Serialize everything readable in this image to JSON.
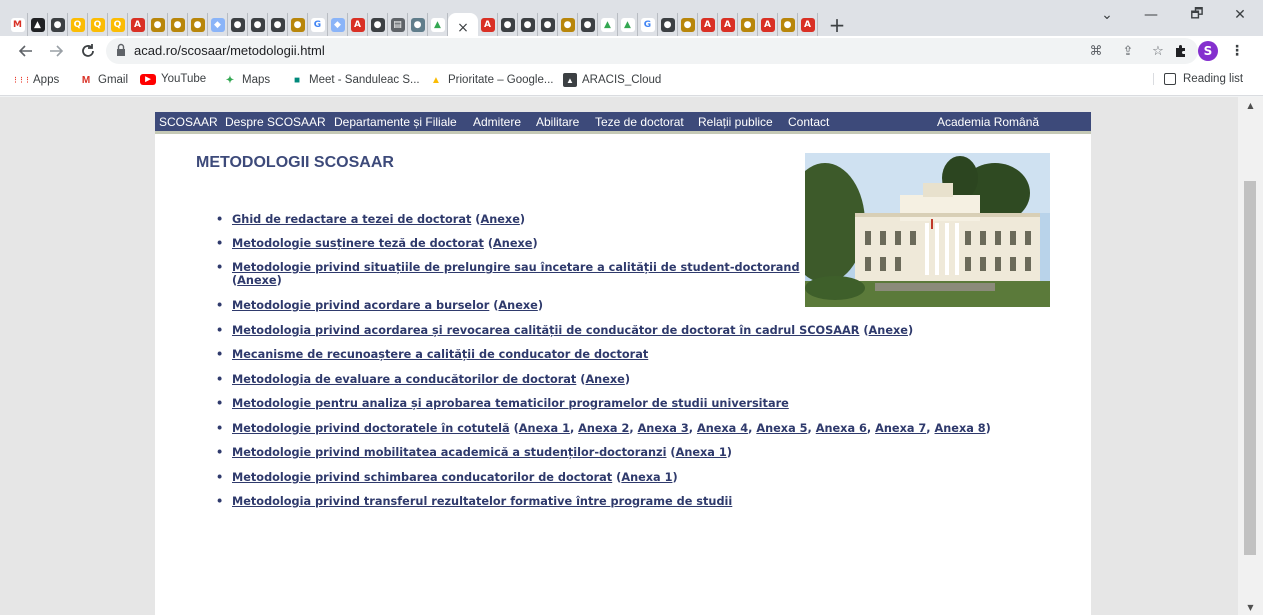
{
  "browser": {
    "tabs": {
      "favicons": [
        {
          "name": "gmail-icon",
          "glyph": "M",
          "bg": "#ffffff",
          "fg": "#d93025"
        },
        {
          "name": "aracis-icon",
          "glyph": "▲",
          "bg": "#202124",
          "fg": "#ffffff"
        },
        {
          "name": "chrome-icon",
          "glyph": "●",
          "bg": "#3c4043",
          "fg": "#ffffff"
        },
        {
          "name": "search-icon",
          "glyph": "Q",
          "bg": "#fbbc04",
          "fg": "#ffffff"
        },
        {
          "name": "search-icon",
          "glyph": "Q",
          "bg": "#fbbc04",
          "fg": "#ffffff"
        },
        {
          "name": "search-icon",
          "glyph": "Q",
          "bg": "#fbbc04",
          "fg": "#ffffff"
        },
        {
          "name": "pdf-icon",
          "glyph": "A",
          "bg": "#d93025",
          "fg": "#ffffff"
        },
        {
          "name": "seal-icon",
          "glyph": "●",
          "bg": "#b8860b",
          "fg": "#ffffff"
        },
        {
          "name": "seal-icon",
          "glyph": "●",
          "bg": "#b8860b",
          "fg": "#ffffff"
        },
        {
          "name": "seal-icon",
          "glyph": "●",
          "bg": "#b8860b",
          "fg": "#ffffff"
        },
        {
          "name": "diamond-icon",
          "glyph": "◆",
          "bg": "#8ab4f8",
          "fg": "#ffffff"
        },
        {
          "name": "chrome-icon",
          "glyph": "●",
          "bg": "#3c4043",
          "fg": "#ffffff"
        },
        {
          "name": "chrome-icon",
          "glyph": "●",
          "bg": "#3c4043",
          "fg": "#ffffff"
        },
        {
          "name": "chrome-icon",
          "glyph": "●",
          "bg": "#3c4043",
          "fg": "#ffffff"
        },
        {
          "name": "seal-icon",
          "glyph": "●",
          "bg": "#b8860b",
          "fg": "#ffffff"
        },
        {
          "name": "google-icon",
          "glyph": "G",
          "bg": "#ffffff",
          "fg": "#4285f4"
        },
        {
          "name": "diamond-icon",
          "glyph": "◆",
          "bg": "#8ab4f8",
          "fg": "#ffffff"
        },
        {
          "name": "pdf-icon",
          "glyph": "A",
          "bg": "#d93025",
          "fg": "#ffffff"
        },
        {
          "name": "chrome-icon",
          "glyph": "●",
          "bg": "#3c4043",
          "fg": "#ffffff"
        },
        {
          "name": "doc-icon",
          "glyph": "▤",
          "bg": "#5f6368",
          "fg": "#ffffff"
        },
        {
          "name": "seal-icon",
          "glyph": "●",
          "bg": "#607d8b",
          "fg": "#ffffff"
        },
        {
          "name": "drive-icon",
          "glyph": "▲",
          "bg": "#ffffff",
          "fg": "#34a853"
        }
      ],
      "active_close": "×",
      "favicons_after": [
        {
          "name": "pdf-icon",
          "glyph": "A",
          "bg": "#d93025",
          "fg": "#ffffff"
        },
        {
          "name": "chrome-icon",
          "glyph": "●",
          "bg": "#3c4043",
          "fg": "#ffffff"
        },
        {
          "name": "chrome-icon",
          "glyph": "●",
          "bg": "#3c4043",
          "fg": "#ffffff"
        },
        {
          "name": "chrome-icon",
          "glyph": "●",
          "bg": "#3c4043",
          "fg": "#ffffff"
        },
        {
          "name": "seal-icon",
          "glyph": "●",
          "bg": "#b8860b",
          "fg": "#ffffff"
        },
        {
          "name": "chrome-icon",
          "glyph": "●",
          "bg": "#3c4043",
          "fg": "#ffffff"
        },
        {
          "name": "drive-icon",
          "glyph": "▲",
          "bg": "#ffffff",
          "fg": "#34a853"
        },
        {
          "name": "drive-icon",
          "glyph": "▲",
          "bg": "#ffffff",
          "fg": "#34a853"
        },
        {
          "name": "google-icon",
          "glyph": "G",
          "bg": "#ffffff",
          "fg": "#4285f4"
        },
        {
          "name": "chrome-icon",
          "glyph": "●",
          "bg": "#3c4043",
          "fg": "#ffffff"
        },
        {
          "name": "seal-icon",
          "glyph": "●",
          "bg": "#b8860b",
          "fg": "#ffffff"
        },
        {
          "name": "pdf-icon",
          "glyph": "A",
          "bg": "#d93025",
          "fg": "#ffffff"
        },
        {
          "name": "pdf-icon",
          "glyph": "A",
          "bg": "#d93025",
          "fg": "#ffffff"
        },
        {
          "name": "seal-icon",
          "glyph": "●",
          "bg": "#b8860b",
          "fg": "#ffffff"
        },
        {
          "name": "pdf-icon",
          "glyph": "A",
          "bg": "#d93025",
          "fg": "#ffffff"
        },
        {
          "name": "seal-icon",
          "glyph": "●",
          "bg": "#b8860b",
          "fg": "#ffffff"
        },
        {
          "name": "pdf-icon",
          "glyph": "A",
          "bg": "#d93025",
          "fg": "#ffffff"
        }
      ],
      "new_tab": "+"
    },
    "window_controls": {
      "tab_search": "⌄",
      "minimize": "—",
      "maximize": "🗗",
      "close": "✕"
    },
    "url": "acad.ro/scosaar/metodologii.html",
    "profile_initial": "S",
    "bookmarks": [
      {
        "label": "Apps",
        "icon": "apps-icon",
        "glyph": "⋮⋮⋮",
        "color": "#ea4335"
      },
      {
        "label": "Gmail",
        "icon": "gmail-icon",
        "glyph": "M",
        "color": "#d93025"
      },
      {
        "label": "YouTube",
        "icon": "youtube-icon",
        "glyph": "▶",
        "color": "#ff0000"
      },
      {
        "label": "Maps",
        "icon": "maps-icon",
        "glyph": "✦",
        "color": "#34a853"
      },
      {
        "label": "Meet - Sanduleac S...",
        "icon": "meet-icon",
        "glyph": "■",
        "color": "#00897b"
      },
      {
        "label": "Prioritate – Google...",
        "icon": "drive-icon",
        "glyph": "▲",
        "color": "#fbbc04"
      },
      {
        "label": "ARACIS_Cloud",
        "icon": "cloud-icon",
        "glyph": "▲",
        "color": "#3c4043"
      }
    ],
    "reading_list": "Reading list"
  },
  "site": {
    "nav": [
      "SCOSAAR",
      "Despre SCOSAAR",
      "Departamente și Filiale",
      "Admitere",
      "Abilitare",
      "Teze de doctorat",
      "Relații publice",
      "Contact"
    ],
    "nav_right": "Academia Română",
    "title": "METODOLOGII SCOSAAR",
    "items": [
      {
        "text": "Ghid de redactare a tezei de doctorat",
        "annexes": [
          "Anexe"
        ]
      },
      {
        "text": "Metodologie susținere teză de doctorat",
        "annexes": [
          "Anexe"
        ]
      },
      {
        "text": "Metodologie privind situațiile de prelungire sau încetare a calității de student-doctorand",
        "annexes": [
          "Anexe"
        ],
        "wrap": true
      },
      {
        "text": "Metodologie privind acordare a burselor",
        "annexes": [
          "Anexe"
        ]
      },
      {
        "text": "Metodologia privind acordarea și revocarea calității de conducător de doctorat în cadrul SCOSAAR",
        "annexes": [
          "Anexe"
        ]
      },
      {
        "text": "Mecanisme de recunoaștere a calității de conducator de doctorat",
        "annexes": []
      },
      {
        "text": "Metodologia de evaluare a conducătorilor de doctorat",
        "annexes": [
          "Anexe"
        ]
      },
      {
        "text": "Metodologie pentru analiza și aprobarea tematicilor programelor de studii universitare",
        "annexes": []
      },
      {
        "text": "Metodologie privind doctoratele în cotutelă",
        "annexes": [
          "Anexa 1",
          "Anexa 2",
          "Anexa 3",
          "Anexa 4",
          "Anexa 5",
          "Anexa 6",
          "Anexa 7",
          "Anexa 8"
        ]
      },
      {
        "text": "Metodologie privind mobilitatea academică a studenților-doctoranzi",
        "annexes": [
          "Anexa 1"
        ]
      },
      {
        "text": "Metodologie privind schimbarea conducatorilor de doctorat",
        "annexes": [
          "Anexa 1"
        ]
      },
      {
        "text": "Metodologia privind transferul rezultatelor formative între programe de studii",
        "annexes": []
      }
    ],
    "bullet": "•"
  }
}
